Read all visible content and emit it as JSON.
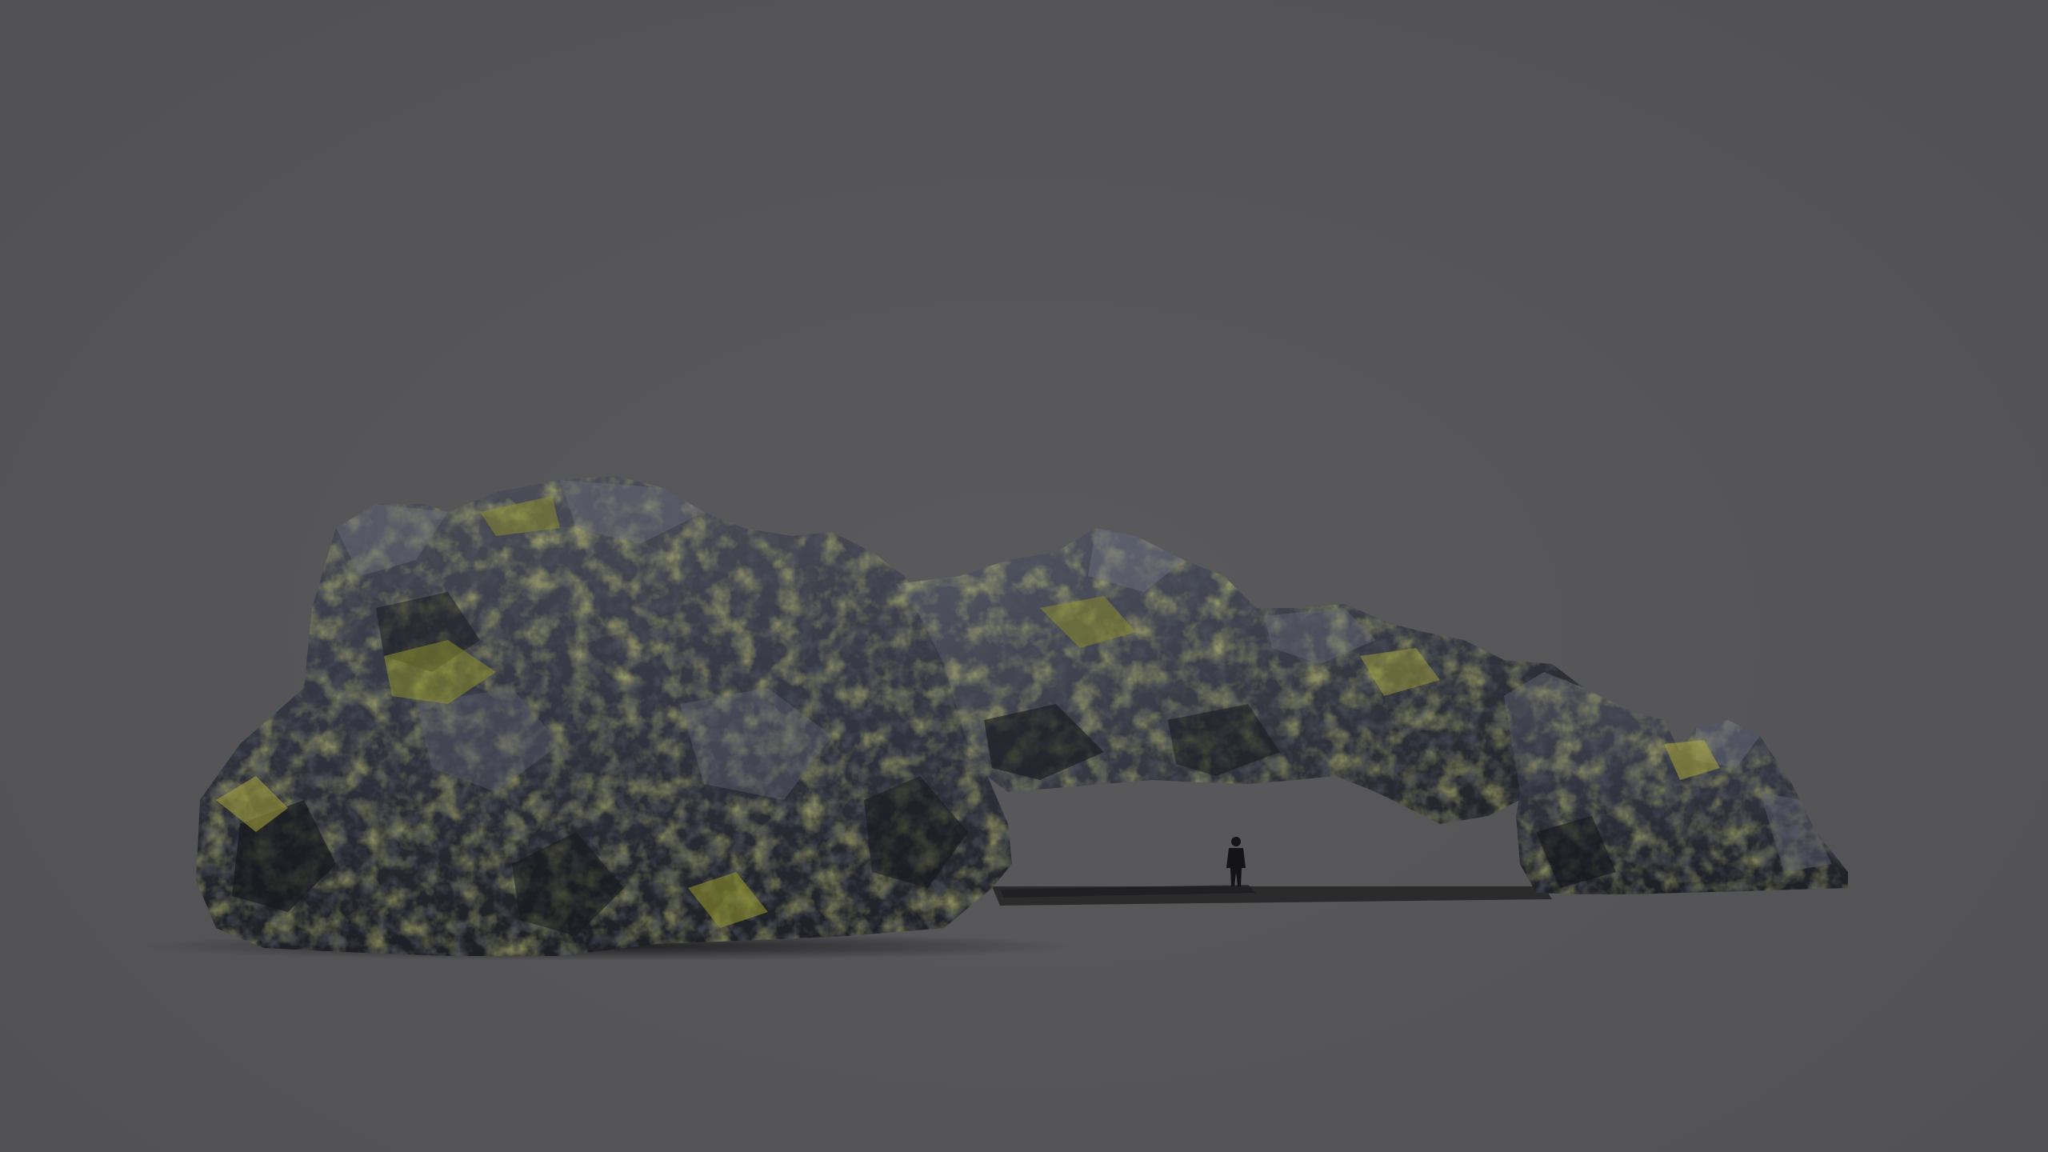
{
  "scene": {
    "background_color": "#565658",
    "subject": "rock-arch",
    "rock_colors": {
      "dark": "#1f2228",
      "mid": "#3a3e48",
      "light": "#5f6170",
      "moss": "#8d8f2c",
      "moss_bright": "#a9a63a",
      "shadow": "#262628"
    },
    "human_silhouette_color": "#141416"
  }
}
